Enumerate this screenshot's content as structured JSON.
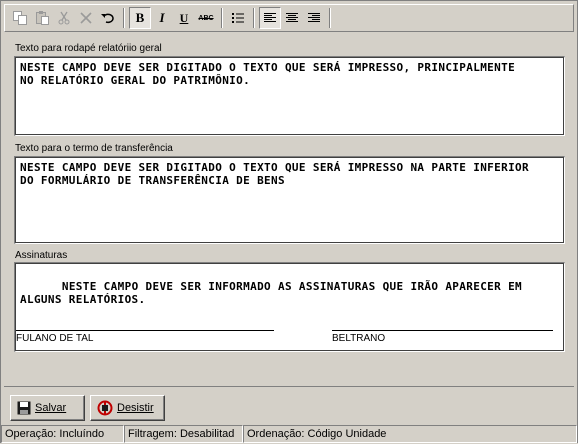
{
  "toolbar": {
    "buttons": [
      {
        "name": "copy-icon",
        "glyph": ""
      },
      {
        "name": "paste-icon",
        "glyph": ""
      },
      {
        "name": "cut-icon",
        "glyph": ""
      },
      {
        "name": "delete-icon",
        "glyph": ""
      },
      {
        "name": "undo-icon",
        "glyph": ""
      },
      {
        "name": "bold-icon",
        "glyph": "B"
      },
      {
        "name": "italic-icon",
        "glyph": "I"
      },
      {
        "name": "underline-icon",
        "glyph": "U"
      },
      {
        "name": "strikethrough-icon",
        "glyph": "ABC"
      },
      {
        "name": "bullet-list-icon",
        "glyph": ""
      },
      {
        "name": "align-left-icon",
        "glyph": ""
      },
      {
        "name": "align-center-icon",
        "glyph": ""
      },
      {
        "name": "align-right-icon",
        "glyph": ""
      }
    ]
  },
  "fields": {
    "footer_label": "Texto para rodapé relatóriio geral",
    "footer_text": "NESTE CAMPO DEVE SER DIGITADO O TEXTO QUE SERÁ IMPRESSO, PRINCIPALMENTE\nNO RELATÓRIO GERAL DO PATRIMÔNIO.",
    "transfer_label": "Texto para o termo de transferência",
    "transfer_text": "NESTE CAMPO DEVE SER DIGITADO O TEXTO QUE SERÁ IMPRESSO NA PARTE INFERIOR\nDO FORMULÁRIO DE TRANSFERÊNCIA DE BENS",
    "signatures_label": "Assinaturas",
    "signatures_text": "NESTE CAMPO DEVE SER INFORMADO AS ASSINATURAS QUE IRÃO APARECER EM\nALGUNS RELATÓRIOS.",
    "signature_1": "FULANO DE TAL",
    "signature_2": "BELTRANO"
  },
  "buttons": {
    "save_label": "Salvar",
    "cancel_label": "Desistir"
  },
  "status": {
    "operation": "Operação: Incluíndo",
    "filter": "Filtragem: Desabilitad",
    "order": "Ordenação: Código Unidade"
  },
  "colors": {
    "background": "#d4d0c8",
    "cancel_icon": "#c00000",
    "save_icon": "#1a1a1a"
  }
}
